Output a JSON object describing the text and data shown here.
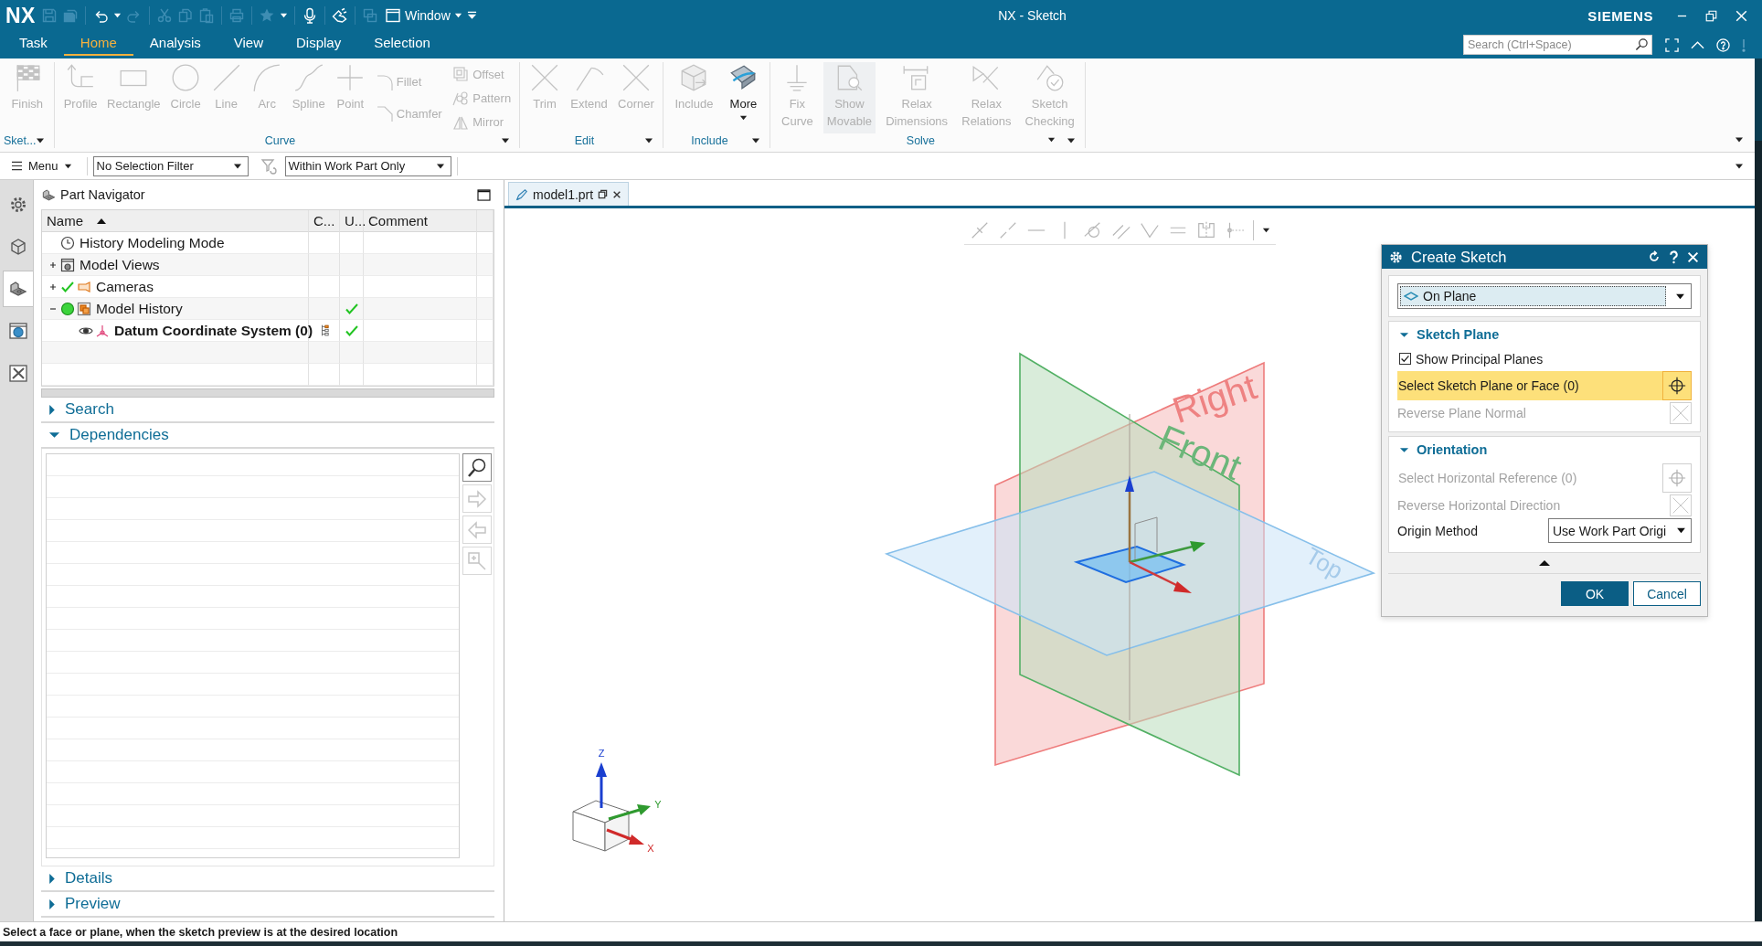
{
  "title_bar": {
    "logo": "NX",
    "quick_access": [
      {
        "disabled": true
      },
      {
        "disabled": true
      },
      {
        "disabled": false
      },
      {
        "disabled": false
      },
      {
        "disabled": true
      },
      {
        "disabled": true
      },
      {
        "disabled": true
      },
      {
        "disabled": true
      },
      {
        "disabled": true
      },
      {
        "disabled": true
      },
      {
        "disabled": false
      },
      {
        "disabled": false
      },
      {
        "disabled": false
      },
      {
        "disabled": true
      }
    ],
    "window_menu": "Window",
    "title": "NX - Sketch",
    "brand": "SIEMENS"
  },
  "ribbon_tabs": [
    {
      "label": "Task",
      "selected": false
    },
    {
      "label": "Home",
      "selected": true
    },
    {
      "label": "Analysis",
      "selected": false
    },
    {
      "label": "View",
      "selected": false
    },
    {
      "label": "Display",
      "selected": false
    },
    {
      "label": "Selection",
      "selected": false
    }
  ],
  "search": {
    "placeholder": "Search (Ctrl+Space)"
  },
  "ribbon": {
    "groups": [
      {
        "label": "Sket...",
        "menu": true,
        "items": [
          {
            "kind": "large",
            "label": "Finish",
            "disabled": true,
            "on": false,
            "menu": false
          }
        ]
      },
      {
        "label": "Curve",
        "menu": true,
        "items": [
          {
            "kind": "large",
            "label": "Profile",
            "disabled": true,
            "on": false,
            "menu": false
          },
          {
            "kind": "large",
            "label": "Rectangle",
            "disabled": true,
            "on": false,
            "menu": false
          },
          {
            "kind": "large",
            "label": "Circle",
            "disabled": true,
            "on": false,
            "menu": false
          },
          {
            "kind": "large",
            "label": "Line",
            "disabled": true,
            "on": false,
            "menu": false
          },
          {
            "kind": "large",
            "label": "Arc",
            "disabled": true,
            "on": false,
            "menu": false
          },
          {
            "kind": "large",
            "label": "Spline",
            "disabled": true,
            "on": false,
            "menu": false
          },
          {
            "kind": "large",
            "label": "Point",
            "disabled": true,
            "on": false,
            "menu": false
          },
          {
            "kind": "stack",
            "buttons": [
              {
                "label": "Fillet",
                "disabled": true
              },
              {
                "label": "Chamfer",
                "disabled": true
              }
            ]
          },
          {
            "kind": "stack",
            "buttons": [
              {
                "label": "Offset",
                "disabled": true
              },
              {
                "label": "Pattern",
                "disabled": true
              },
              {
                "label": "Mirror",
                "disabled": true
              }
            ]
          }
        ]
      },
      {
        "label": "Edit",
        "menu": true,
        "items": [
          {
            "kind": "large",
            "label": "Trim",
            "disabled": true,
            "on": false,
            "menu": false
          },
          {
            "kind": "large",
            "label": "Extend",
            "disabled": true,
            "on": false,
            "menu": false
          },
          {
            "kind": "large",
            "label": "Corner",
            "disabled": true,
            "on": false,
            "menu": false
          }
        ]
      },
      {
        "label": "Include",
        "menu": true,
        "items": [
          {
            "kind": "large",
            "label": "Include",
            "disabled": true,
            "on": false,
            "menu": false
          },
          {
            "kind": "split",
            "label": "More",
            "disabled": false
          }
        ]
      },
      {
        "label": "Solve",
        "menu": true,
        "items": [
          {
            "kind": "large",
            "label": "Fix Curve",
            "disabled": true,
            "on": false,
            "menu": false
          },
          {
            "kind": "large",
            "label": "Show Movable",
            "disabled": true,
            "on": true,
            "menu": false
          },
          {
            "kind": "large",
            "label": "Relax Dimensions",
            "disabled": true,
            "on": false,
            "menu": false
          },
          {
            "kind": "large",
            "label": "Relax Relations",
            "disabled": true,
            "on": false,
            "menu": false
          },
          {
            "kind": "large",
            "label": "Sketch Checking",
            "disabled": true,
            "on": false,
            "menu": true
          }
        ]
      }
    ]
  },
  "selection_bar": {
    "menu": "Menu",
    "filter": "No Selection Filter",
    "scope": "Within Work Part Only"
  },
  "resource_bar": [
    {
      "selected": false
    },
    {
      "selected": false
    },
    {
      "selected": true
    },
    {
      "selected": false
    },
    {
      "selected": false
    }
  ],
  "navigator": {
    "title": "Part Navigator",
    "columns": [
      "Name",
      "C...",
      "U...",
      "Comment"
    ],
    "rows": [
      {
        "kind": "mode",
        "name": "History Modeling Mode",
        "current": false,
        "c_marker": false,
        "up_to_date": false
      },
      {
        "kind": "views",
        "name": "Model Views",
        "expanded": false,
        "current": false,
        "c_marker": false,
        "up_to_date": false
      },
      {
        "kind": "cameras",
        "name": "Cameras",
        "expanded": false,
        "current": false,
        "c_marker": false,
        "up_to_date": false
      },
      {
        "kind": "history",
        "name": "Model History",
        "expanded": true,
        "current": false,
        "c_marker": false,
        "up_to_date": true,
        "children": [
          {
            "kind": "csys",
            "name": "Datum Coordinate System (0)",
            "current": true,
            "c_marker": true,
            "up_to_date": true
          }
        ]
      }
    ],
    "sections": [
      {
        "label": "Search",
        "expanded": false
      },
      {
        "label": "Dependencies",
        "expanded": true
      },
      {
        "label": "Details",
        "expanded": false
      },
      {
        "label": "Preview",
        "expanded": false
      }
    ],
    "dependency_tools": [
      {
        "disabled": false
      },
      {
        "disabled": true
      },
      {
        "disabled": true
      },
      {
        "disabled": true
      }
    ]
  },
  "viewport": {
    "tab": "model1.prt",
    "plane_labels": [
      "Right",
      "Front",
      "Top"
    ],
    "triad_labels": [
      "Z",
      "Y",
      "X"
    ]
  },
  "dialog": {
    "title": "Create Sketch",
    "type": "On Plane",
    "sections": [
      {
        "title": "Sketch Plane",
        "expanded": true,
        "rows": [
          {
            "kind": "checkbox",
            "label": "Show Principal Planes",
            "checked": true,
            "disabled": false
          },
          {
            "kind": "selection",
            "label": "Select Sketch Plane or Face (0)",
            "active": true,
            "disabled": false
          },
          {
            "kind": "toggle",
            "label": "Reverse Plane Normal",
            "disabled": true
          }
        ]
      },
      {
        "title": "Orientation",
        "expanded": true,
        "rows": [
          {
            "kind": "selection",
            "label": "Select Horizontal Reference (0)",
            "active": false,
            "disabled": true
          },
          {
            "kind": "toggle",
            "label": "Reverse Horizontal Direction",
            "disabled": true
          },
          {
            "kind": "dropdown",
            "label": "Origin Method",
            "value": "Use Work Part Origi",
            "disabled": false
          }
        ]
      }
    ],
    "buttons": [
      {
        "label": "OK",
        "primary": true
      },
      {
        "label": "Cancel",
        "primary": false
      }
    ]
  },
  "status_bar": {
    "message": "Select a face or plane, when the sketch preview is at the desired location"
  }
}
